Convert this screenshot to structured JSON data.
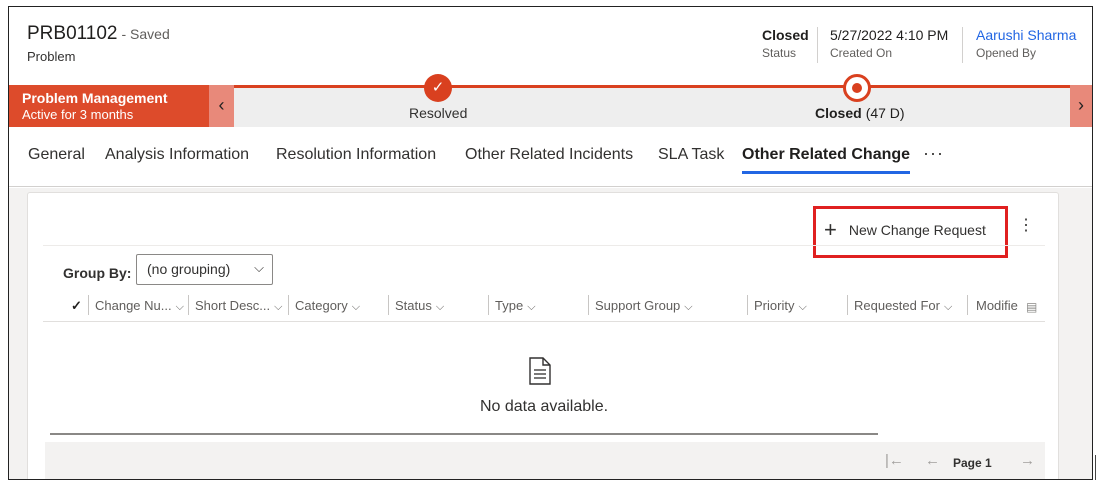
{
  "header": {
    "record_id": "PRB01102",
    "save_state": "- Saved",
    "entity": "Problem",
    "fields": [
      {
        "value": "Closed",
        "label": "Status"
      },
      {
        "value": "5/27/2022 4:10 PM",
        "label": "Created On"
      },
      {
        "value": "Aarushi Sharma",
        "label": "Opened By"
      }
    ]
  },
  "bpf": {
    "process_name": "Problem Management",
    "process_duration": "Active for 3 months",
    "stages": [
      {
        "label": "Resolved",
        "duration": ""
      },
      {
        "label": "Closed",
        "duration": "(47 D)"
      }
    ],
    "prev_icon": "chevron-left-icon",
    "next_icon": "chevron-right-icon",
    "accent_color": "#dd4b2b"
  },
  "tabs": [
    {
      "label": "General"
    },
    {
      "label": "Analysis Information"
    },
    {
      "label": "Resolution Information"
    },
    {
      "label": "Other Related Incidents"
    },
    {
      "label": "SLA Task"
    },
    {
      "label": "Other Related Change"
    }
  ],
  "tab_more": "···",
  "commands": {
    "new_label": "New Change Request",
    "new_icon": "plus-icon",
    "more": "⋮"
  },
  "groupby": {
    "label": "Group By:",
    "value": "(no grouping)"
  },
  "grid": {
    "columns": [
      "Change Nu...",
      "Short Desc...",
      "Category",
      "Status",
      "Type",
      "Support Group",
      "Priority",
      "Requested For",
      "Modifie"
    ],
    "empty_text": "No data available."
  },
  "pager": {
    "label": "Page 1"
  }
}
